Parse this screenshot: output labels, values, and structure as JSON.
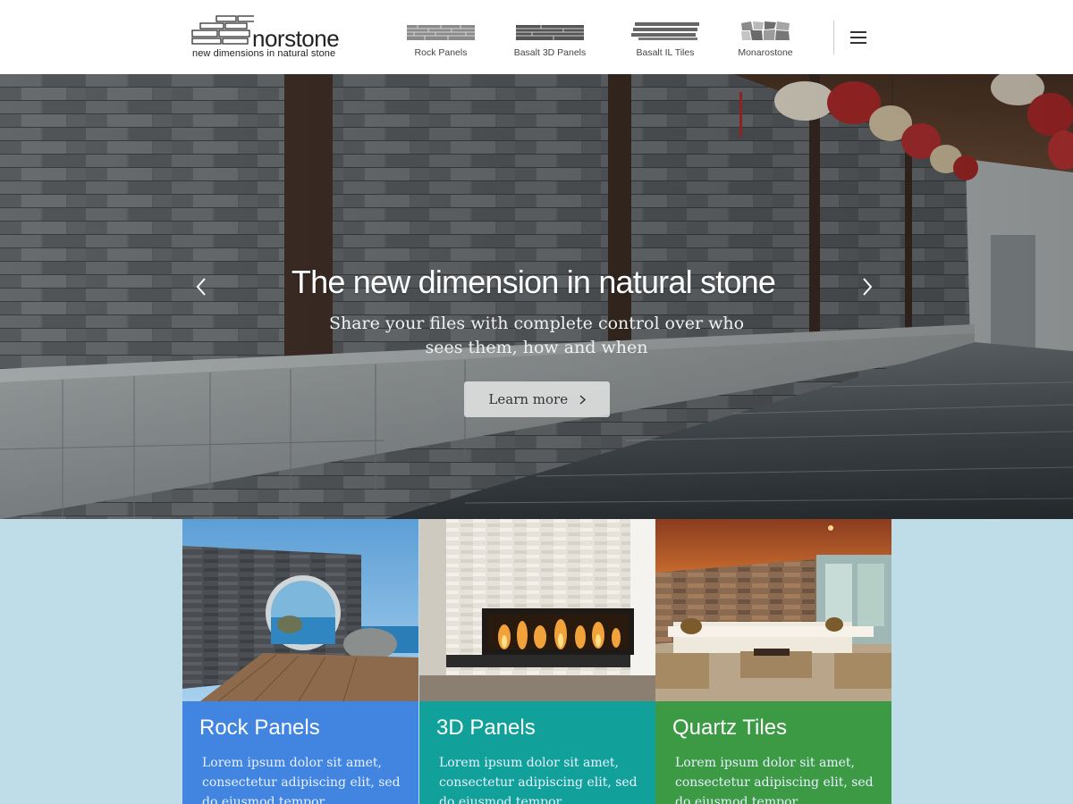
{
  "brand": {
    "name": "norstone",
    "tagline": "new dimensions in natural stone"
  },
  "nav": {
    "items": [
      {
        "label": "Rock Panels",
        "icon": "rock-panels-icon"
      },
      {
        "label": "Basalt 3D Panels",
        "icon": "basalt-3d-panels-icon"
      },
      {
        "label": "Basalt IL Tiles",
        "icon": "basalt-il-tiles-icon"
      },
      {
        "label": "Monarostone",
        "icon": "monarostone-icon"
      }
    ],
    "menu_icon": "hamburger-menu-icon"
  },
  "hero": {
    "title": "The new dimension in natural stone",
    "subtitle": "Share your files with complete control over who sees them, how and when",
    "button_label": "Learn more",
    "prev_icon": "chevron-left-icon",
    "next_icon": "chevron-right-icon"
  },
  "cards": [
    {
      "title": "Rock Panels",
      "text": "Lorem ipsum dolor sit amet, consectetur adipiscing elit, sed do eiusmod tempor",
      "color": "#4285e0"
    },
    {
      "title": "3D Panels",
      "text": "Lorem ipsum dolor sit amet, consectetur adipiscing elit, sed do eiusmod tempor",
      "color": "#12a19a"
    },
    {
      "title": "Quartz Tiles",
      "text": "Lorem ipsum dolor sit amet, consectetur adipiscing elit, sed do eiusmod tempor",
      "color": "#3c9a45"
    }
  ],
  "colors": {
    "lower_bg": "#bfdde8",
    "header_bg": "#ffffff"
  }
}
